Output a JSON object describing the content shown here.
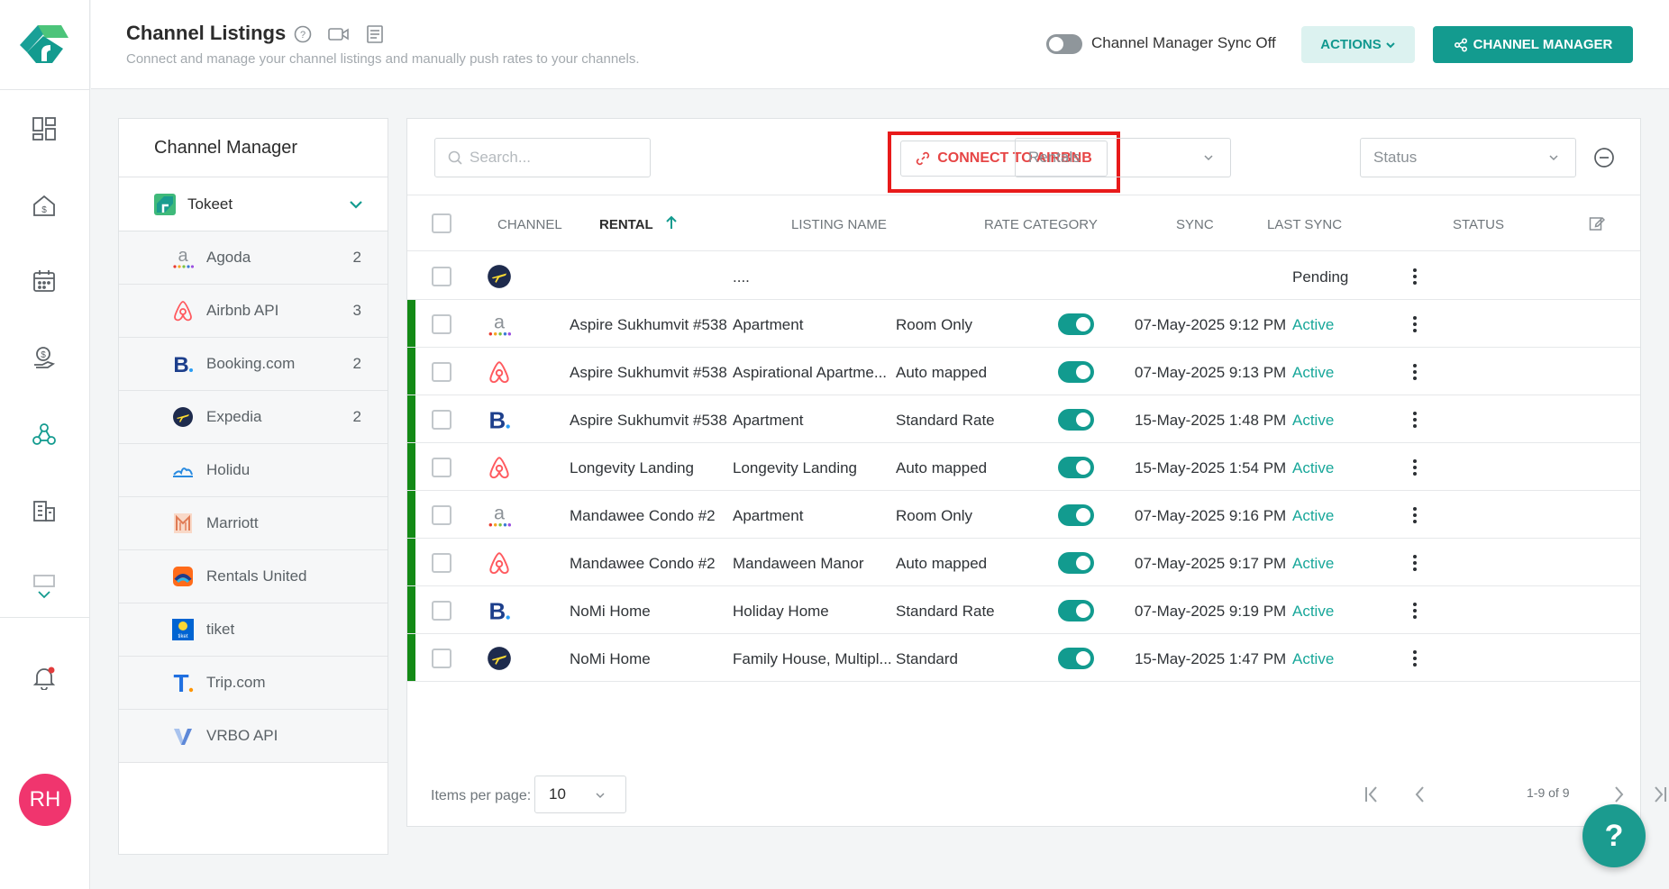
{
  "header": {
    "title": "Channel Listings",
    "subtitle": "Connect and manage your channel listings and manually push rates to your channels.",
    "sync_label": "Channel Manager Sync Off",
    "actions_label": "ACTIONS",
    "channel_manager_label": "CHANNEL MANAGER"
  },
  "nav": {
    "avatar_initials": "RH"
  },
  "panel": {
    "title": "Channel Manager",
    "account": "Tokeet",
    "channels": [
      {
        "name": "Agoda",
        "count": "2",
        "icon": "agoda-icon"
      },
      {
        "name": "Airbnb API",
        "count": "3",
        "icon": "airbnb-icon"
      },
      {
        "name": "Booking.com",
        "count": "2",
        "icon": "booking-icon"
      },
      {
        "name": "Expedia",
        "count": "2",
        "icon": "expedia-icon"
      },
      {
        "name": "Holidu",
        "count": "",
        "icon": "holidu-icon"
      },
      {
        "name": "Marriott",
        "count": "",
        "icon": "marriott-icon"
      },
      {
        "name": "Rentals United",
        "count": "",
        "icon": "rentals-united-icon"
      },
      {
        "name": "tiket",
        "count": "",
        "icon": "tiket-icon"
      },
      {
        "name": "Trip.com",
        "count": "",
        "icon": "trip-icon"
      },
      {
        "name": "VRBO API",
        "count": "",
        "icon": "vrbo-icon"
      }
    ]
  },
  "toolbar": {
    "search_placeholder": "Search...",
    "connect_label": "CONNECT TO AIRBNB",
    "rentals_placeholder": "Rentals",
    "status_placeholder": "Status"
  },
  "table": {
    "headers": {
      "channel": "CHANNEL",
      "rental": "RENTAL",
      "listing": "LISTING NAME",
      "rate": "RATE CATEGORY",
      "sync": "SYNC",
      "last_sync": "LAST SYNC",
      "status": "STATUS"
    },
    "rows": [
      {
        "channel": "expedia",
        "rental": "",
        "listing": "....",
        "rate": "",
        "sync": null,
        "last_sync": "",
        "status": "Pending"
      },
      {
        "channel": "agoda",
        "rental": "Aspire Sukhumvit #538",
        "listing": "Apartment",
        "rate": "Room Only",
        "sync": true,
        "last_sync": "07-May-2025 9:12 PM",
        "status": "Active"
      },
      {
        "channel": "airbnb",
        "rental": "Aspire Sukhumvit #538",
        "listing": "Aspirational Apartme...",
        "rate": "Auto mapped",
        "sync": true,
        "last_sync": "07-May-2025 9:13 PM",
        "status": "Active"
      },
      {
        "channel": "booking",
        "rental": "Aspire Sukhumvit #538",
        "listing": "Apartment",
        "rate": "Standard Rate",
        "sync": true,
        "last_sync": "15-May-2025 1:48 PM",
        "status": "Active"
      },
      {
        "channel": "airbnb",
        "rental": "Longevity Landing",
        "listing": "Longevity Landing",
        "rate": "Auto mapped",
        "sync": true,
        "last_sync": "15-May-2025 1:54 PM",
        "status": "Active"
      },
      {
        "channel": "agoda",
        "rental": "Mandawee Condo #2",
        "listing": "Apartment",
        "rate": "Room Only",
        "sync": true,
        "last_sync": "07-May-2025 9:16 PM",
        "status": "Active"
      },
      {
        "channel": "airbnb",
        "rental": "Mandawee Condo #2",
        "listing": "Mandaween Manor",
        "rate": "Auto mapped",
        "sync": true,
        "last_sync": "07-May-2025 9:17 PM",
        "status": "Active"
      },
      {
        "channel": "booking",
        "rental": "NoMi Home",
        "listing": "Holiday Home",
        "rate": "Standard Rate",
        "sync": true,
        "last_sync": "07-May-2025 9:19 PM",
        "status": "Active"
      },
      {
        "channel": "expedia",
        "rental": "NoMi Home",
        "listing": "Family House, Multipl...",
        "rate": "Standard",
        "sync": true,
        "last_sync": "15-May-2025 1:47 PM",
        "status": "Active"
      }
    ]
  },
  "pagination": {
    "items_per_page_label": "Items per page:",
    "items_per_page_value": "10",
    "range": "1-9 of 9"
  },
  "help_label": "?",
  "colors": {
    "accent": "#139b8f",
    "active_bar": "#138a16",
    "highlight": "#e81a1a"
  }
}
